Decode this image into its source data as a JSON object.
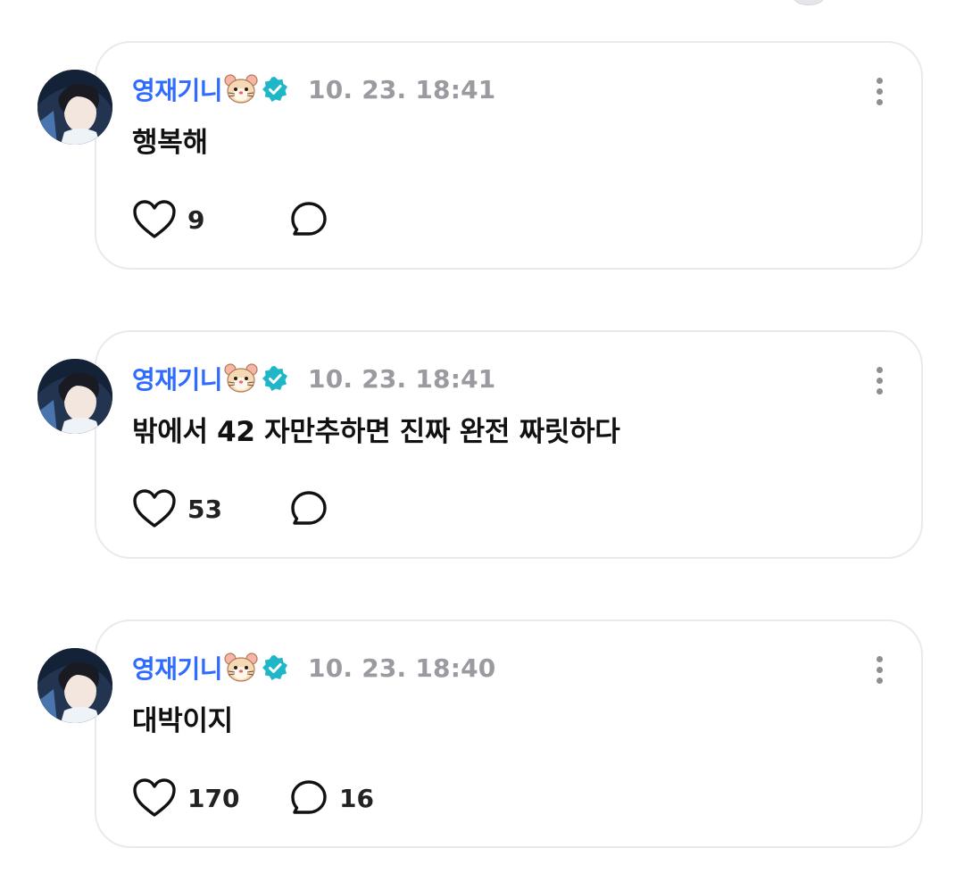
{
  "posts": [
    {
      "username": "영재기니",
      "timestamp": "10. 23. 18:41",
      "content": "행복해",
      "likes": "9",
      "comments": ""
    },
    {
      "username": "영재기니",
      "timestamp": "10. 23. 18:41",
      "content": "밖에서 42 자만추하면 진짜 완전 짜릿하다",
      "likes": "53",
      "comments": ""
    },
    {
      "username": "영재기니",
      "timestamp": "10. 23. 18:40",
      "content": "대박이지",
      "likes": "170",
      "comments": "16"
    }
  ],
  "colors": {
    "username": "#2f6bff",
    "verified": "#1fb6c8",
    "timestamp": "#9a9aa0",
    "card_border": "#e9e9ee"
  },
  "icons": {
    "emoji": "hamster-face-icon",
    "badge": "verified-badge-icon",
    "like": "heart-icon",
    "comment": "chat-bubble-icon",
    "menu": "more-vertical-icon"
  }
}
